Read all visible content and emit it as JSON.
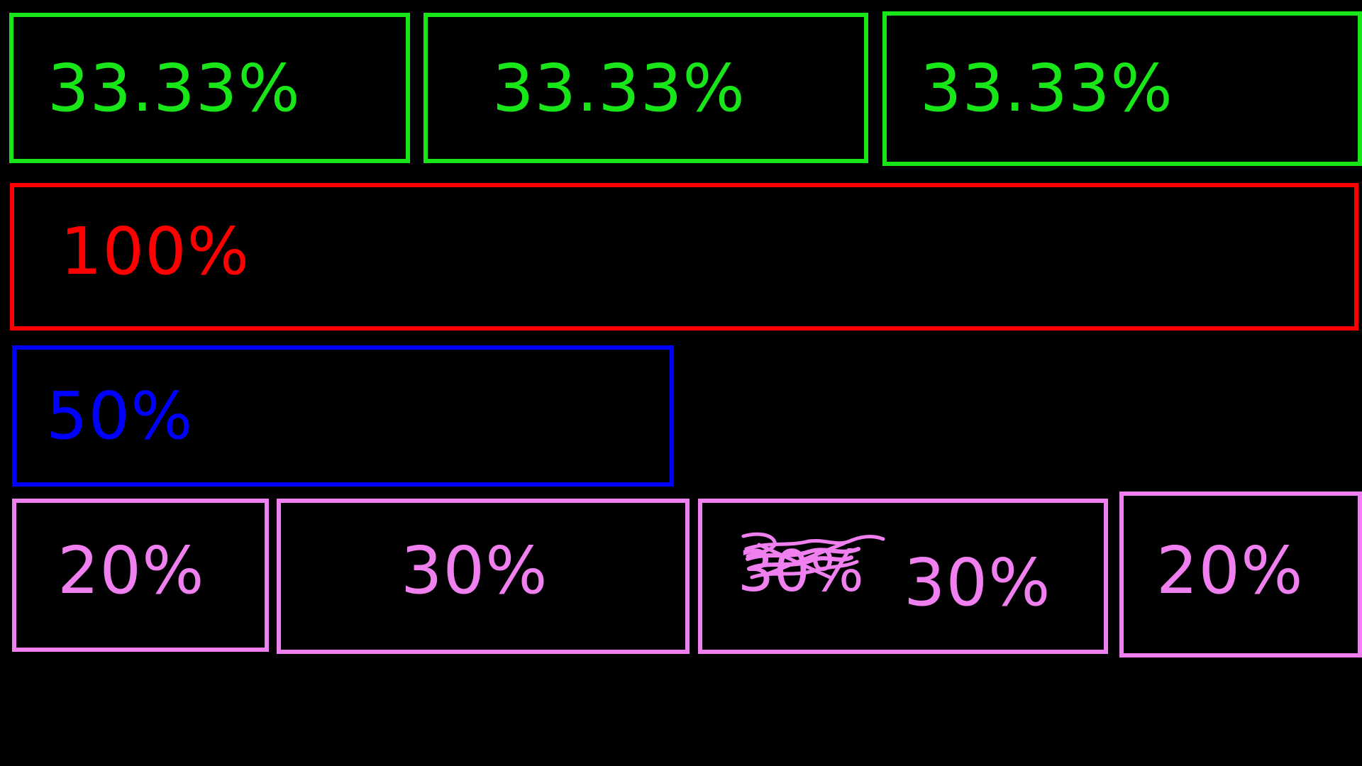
{
  "colors": {
    "background": "#000000",
    "green": "#19e619",
    "red": "#ff0000",
    "blue": "#0000ff",
    "pink": "#f07ff0"
  },
  "rows": {
    "row1": [
      "33.33%",
      "33.33%",
      "33.33%"
    ],
    "row2": [
      "100%"
    ],
    "row3": [
      "50%"
    ],
    "row4": [
      "20%",
      "30%",
      "30%",
      "20%"
    ]
  },
  "scribble_text": "30%"
}
